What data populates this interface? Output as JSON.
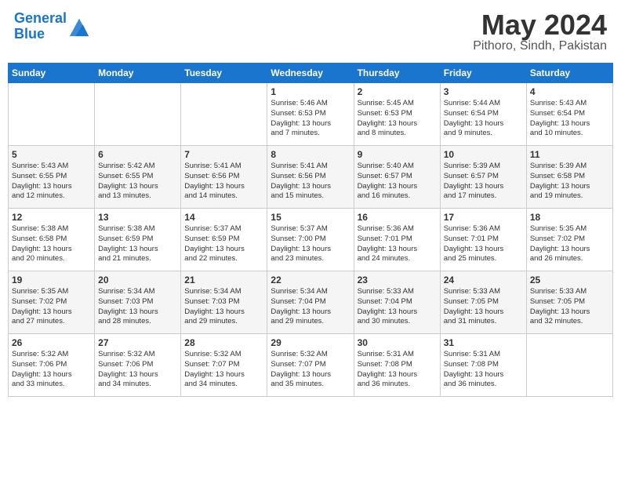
{
  "header": {
    "logo_line1": "General",
    "logo_line2": "Blue",
    "title": "May 2024",
    "subtitle": "Pithoro, Sindh, Pakistan"
  },
  "weekdays": [
    "Sunday",
    "Monday",
    "Tuesday",
    "Wednesday",
    "Thursday",
    "Friday",
    "Saturday"
  ],
  "weeks": [
    [
      {
        "day": "",
        "info": ""
      },
      {
        "day": "",
        "info": ""
      },
      {
        "day": "",
        "info": ""
      },
      {
        "day": "1",
        "info": "Sunrise: 5:46 AM\nSunset: 6:53 PM\nDaylight: 13 hours\nand 7 minutes."
      },
      {
        "day": "2",
        "info": "Sunrise: 5:45 AM\nSunset: 6:53 PM\nDaylight: 13 hours\nand 8 minutes."
      },
      {
        "day": "3",
        "info": "Sunrise: 5:44 AM\nSunset: 6:54 PM\nDaylight: 13 hours\nand 9 minutes."
      },
      {
        "day": "4",
        "info": "Sunrise: 5:43 AM\nSunset: 6:54 PM\nDaylight: 13 hours\nand 10 minutes."
      }
    ],
    [
      {
        "day": "5",
        "info": "Sunrise: 5:43 AM\nSunset: 6:55 PM\nDaylight: 13 hours\nand 12 minutes."
      },
      {
        "day": "6",
        "info": "Sunrise: 5:42 AM\nSunset: 6:55 PM\nDaylight: 13 hours\nand 13 minutes."
      },
      {
        "day": "7",
        "info": "Sunrise: 5:41 AM\nSunset: 6:56 PM\nDaylight: 13 hours\nand 14 minutes."
      },
      {
        "day": "8",
        "info": "Sunrise: 5:41 AM\nSunset: 6:56 PM\nDaylight: 13 hours\nand 15 minutes."
      },
      {
        "day": "9",
        "info": "Sunrise: 5:40 AM\nSunset: 6:57 PM\nDaylight: 13 hours\nand 16 minutes."
      },
      {
        "day": "10",
        "info": "Sunrise: 5:39 AM\nSunset: 6:57 PM\nDaylight: 13 hours\nand 17 minutes."
      },
      {
        "day": "11",
        "info": "Sunrise: 5:39 AM\nSunset: 6:58 PM\nDaylight: 13 hours\nand 19 minutes."
      }
    ],
    [
      {
        "day": "12",
        "info": "Sunrise: 5:38 AM\nSunset: 6:58 PM\nDaylight: 13 hours\nand 20 minutes."
      },
      {
        "day": "13",
        "info": "Sunrise: 5:38 AM\nSunset: 6:59 PM\nDaylight: 13 hours\nand 21 minutes."
      },
      {
        "day": "14",
        "info": "Sunrise: 5:37 AM\nSunset: 6:59 PM\nDaylight: 13 hours\nand 22 minutes."
      },
      {
        "day": "15",
        "info": "Sunrise: 5:37 AM\nSunset: 7:00 PM\nDaylight: 13 hours\nand 23 minutes."
      },
      {
        "day": "16",
        "info": "Sunrise: 5:36 AM\nSunset: 7:01 PM\nDaylight: 13 hours\nand 24 minutes."
      },
      {
        "day": "17",
        "info": "Sunrise: 5:36 AM\nSunset: 7:01 PM\nDaylight: 13 hours\nand 25 minutes."
      },
      {
        "day": "18",
        "info": "Sunrise: 5:35 AM\nSunset: 7:02 PM\nDaylight: 13 hours\nand 26 minutes."
      }
    ],
    [
      {
        "day": "19",
        "info": "Sunrise: 5:35 AM\nSunset: 7:02 PM\nDaylight: 13 hours\nand 27 minutes."
      },
      {
        "day": "20",
        "info": "Sunrise: 5:34 AM\nSunset: 7:03 PM\nDaylight: 13 hours\nand 28 minutes."
      },
      {
        "day": "21",
        "info": "Sunrise: 5:34 AM\nSunset: 7:03 PM\nDaylight: 13 hours\nand 29 minutes."
      },
      {
        "day": "22",
        "info": "Sunrise: 5:34 AM\nSunset: 7:04 PM\nDaylight: 13 hours\nand 29 minutes."
      },
      {
        "day": "23",
        "info": "Sunrise: 5:33 AM\nSunset: 7:04 PM\nDaylight: 13 hours\nand 30 minutes."
      },
      {
        "day": "24",
        "info": "Sunrise: 5:33 AM\nSunset: 7:05 PM\nDaylight: 13 hours\nand 31 minutes."
      },
      {
        "day": "25",
        "info": "Sunrise: 5:33 AM\nSunset: 7:05 PM\nDaylight: 13 hours\nand 32 minutes."
      }
    ],
    [
      {
        "day": "26",
        "info": "Sunrise: 5:32 AM\nSunset: 7:06 PM\nDaylight: 13 hours\nand 33 minutes."
      },
      {
        "day": "27",
        "info": "Sunrise: 5:32 AM\nSunset: 7:06 PM\nDaylight: 13 hours\nand 34 minutes."
      },
      {
        "day": "28",
        "info": "Sunrise: 5:32 AM\nSunset: 7:07 PM\nDaylight: 13 hours\nand 34 minutes."
      },
      {
        "day": "29",
        "info": "Sunrise: 5:32 AM\nSunset: 7:07 PM\nDaylight: 13 hours\nand 35 minutes."
      },
      {
        "day": "30",
        "info": "Sunrise: 5:31 AM\nSunset: 7:08 PM\nDaylight: 13 hours\nand 36 minutes."
      },
      {
        "day": "31",
        "info": "Sunrise: 5:31 AM\nSunset: 7:08 PM\nDaylight: 13 hours\nand 36 minutes."
      },
      {
        "day": "",
        "info": ""
      }
    ]
  ]
}
